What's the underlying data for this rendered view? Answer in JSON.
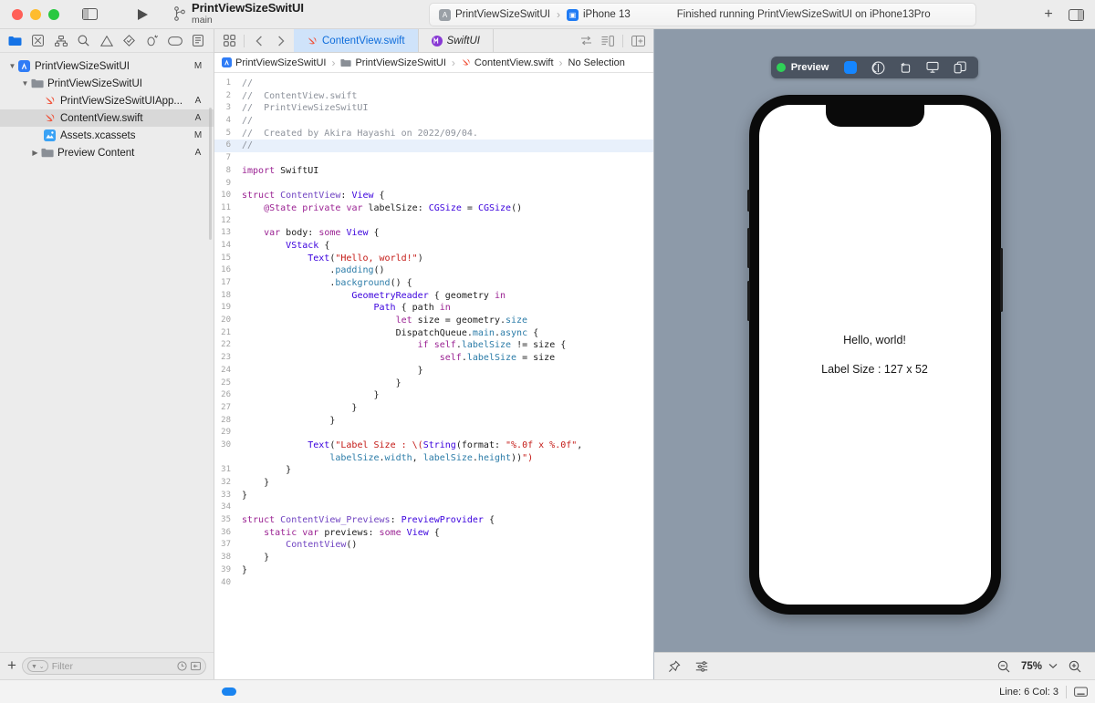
{
  "titlebar": {
    "project_name": "PrintViewSizeSwitUI",
    "branch": "main",
    "run_icon": "run-triangle-icon",
    "sidebar_toggle_icon": "sidebar-toggle-icon",
    "scheme": "PrintViewSizeSwitUI",
    "destination": "iPhone 13",
    "status_message": "Finished running PrintViewSizeSwitUI on iPhone13Pro",
    "add_label": "+",
    "inspector_toggle_icon": "inspector-toggle-icon"
  },
  "navigator": {
    "icons": [
      {
        "name": "folder-icon",
        "active": true
      },
      {
        "name": "source-control-icon",
        "active": false
      },
      {
        "name": "symbol-hierarchy-icon",
        "active": false
      },
      {
        "name": "search-icon",
        "active": false
      },
      {
        "name": "issue-warning-icon",
        "active": false
      },
      {
        "name": "test-diamond-icon",
        "active": false
      },
      {
        "name": "debug-icon",
        "active": false
      },
      {
        "name": "breakpoint-icon",
        "active": false
      },
      {
        "name": "report-icon",
        "active": false
      }
    ],
    "tree": [
      {
        "label": "PrintViewSizeSwitUI",
        "badge": "M",
        "indent": 0,
        "twisty": "open",
        "icon": "xcode-project-icon",
        "selected": false
      },
      {
        "label": "PrintViewSizeSwitUI",
        "badge": "",
        "indent": 1,
        "twisty": "open",
        "icon": "folder-icon",
        "selected": false
      },
      {
        "label": "PrintViewSizeSwitUIApp...",
        "badge": "A",
        "indent": 2,
        "twisty": "none",
        "icon": "swift-file-icon",
        "selected": false
      },
      {
        "label": "ContentView.swift",
        "badge": "A",
        "indent": 2,
        "twisty": "none",
        "icon": "swift-file-icon",
        "selected": true
      },
      {
        "label": "Assets.xcassets",
        "badge": "M",
        "indent": 2,
        "twisty": "none",
        "icon": "assets-icon",
        "selected": false
      },
      {
        "label": "Preview Content",
        "badge": "A",
        "indent": 1,
        "twisty": "closed",
        "icon": "folder-icon",
        "selected": false
      }
    ],
    "bottom": {
      "add_label": "+",
      "filter_placeholder": "Filter",
      "recent_icon": "clock-icon",
      "source-control-filter-icon": "source-control-filter-icon"
    }
  },
  "editor": {
    "tabs": [
      {
        "label": "ContentView.swift",
        "icon": "swift-file-icon",
        "active": true,
        "italic": false
      },
      {
        "label": "SwiftUI",
        "icon": "module-icon",
        "active": false,
        "italic": true
      }
    ],
    "lead_icons": [
      "grid-icon",
      "back-chevron-icon",
      "forward-chevron-icon"
    ],
    "right_icons": [
      "adjust-editor-icon",
      "split-editor-icon",
      "inspector-icon"
    ],
    "breadcrumb": [
      {
        "label": "PrintViewSizeSwitUI",
        "icon": "xcode-project-icon"
      },
      {
        "label": "PrintViewSizeSwitUI",
        "icon": "folder-icon"
      },
      {
        "label": "ContentView.swift",
        "icon": "swift-file-icon"
      },
      {
        "label": "No Selection",
        "icon": "none"
      }
    ],
    "highlighted_line": 6,
    "code": [
      {
        "n": 1,
        "tokens": [
          {
            "t": "//",
            "c": "cm"
          }
        ]
      },
      {
        "n": 2,
        "tokens": [
          {
            "t": "//  ContentView.swift",
            "c": "cm"
          }
        ]
      },
      {
        "n": 3,
        "tokens": [
          {
            "t": "//  PrintViewSizeSwitUI",
            "c": "cm"
          }
        ]
      },
      {
        "n": 4,
        "tokens": [
          {
            "t": "//",
            "c": "cm"
          }
        ]
      },
      {
        "n": 5,
        "tokens": [
          {
            "t": "//  Created by Akira Hayashi on 2022/09/04.",
            "c": "cm"
          }
        ]
      },
      {
        "n": 6,
        "tokens": [
          {
            "t": "//",
            "c": "cm"
          }
        ]
      },
      {
        "n": 7,
        "tokens": []
      },
      {
        "n": 8,
        "tokens": [
          {
            "t": "import",
            "c": "kw"
          },
          {
            "t": " ",
            "c": ""
          },
          {
            "t": "SwiftUI",
            "c": ""
          }
        ]
      },
      {
        "n": 9,
        "tokens": []
      },
      {
        "n": 10,
        "tokens": [
          {
            "t": "struct",
            "c": "kw"
          },
          {
            "t": " ",
            "c": ""
          },
          {
            "t": "ContentView",
            "c": "pl"
          },
          {
            "t": ": ",
            "c": ""
          },
          {
            "t": "View",
            "c": "ty"
          },
          {
            "t": " {",
            "c": ""
          }
        ]
      },
      {
        "n": 11,
        "tokens": [
          {
            "t": "    @State",
            "c": "kw"
          },
          {
            "t": " ",
            "c": ""
          },
          {
            "t": "private",
            "c": "kw"
          },
          {
            "t": " ",
            "c": ""
          },
          {
            "t": "var",
            "c": "kw"
          },
          {
            "t": " labelSize: ",
            "c": ""
          },
          {
            "t": "CGSize",
            "c": "ty"
          },
          {
            "t": " = ",
            "c": ""
          },
          {
            "t": "CGSize",
            "c": "ty"
          },
          {
            "t": "()",
            "c": ""
          }
        ]
      },
      {
        "n": 12,
        "tokens": []
      },
      {
        "n": 13,
        "tokens": [
          {
            "t": "    ",
            "c": ""
          },
          {
            "t": "var",
            "c": "kw"
          },
          {
            "t": " body: ",
            "c": ""
          },
          {
            "t": "some",
            "c": "kw"
          },
          {
            "t": " ",
            "c": ""
          },
          {
            "t": "View",
            "c": "ty"
          },
          {
            "t": " {",
            "c": ""
          }
        ]
      },
      {
        "n": 14,
        "tokens": [
          {
            "t": "        ",
            "c": ""
          },
          {
            "t": "VStack",
            "c": "ty"
          },
          {
            "t": " {",
            "c": ""
          }
        ]
      },
      {
        "n": 15,
        "tokens": [
          {
            "t": "            ",
            "c": ""
          },
          {
            "t": "Text",
            "c": "ty"
          },
          {
            "t": "(",
            "c": ""
          },
          {
            "t": "\"Hello, world!\"",
            "c": "str"
          },
          {
            "t": ")",
            "c": ""
          }
        ]
      },
      {
        "n": 16,
        "tokens": [
          {
            "t": "                .",
            "c": ""
          },
          {
            "t": "padding",
            "c": "fn"
          },
          {
            "t": "()",
            "c": ""
          }
        ]
      },
      {
        "n": 17,
        "tokens": [
          {
            "t": "                .",
            "c": ""
          },
          {
            "t": "background",
            "c": "fn"
          },
          {
            "t": "() {",
            "c": ""
          }
        ]
      },
      {
        "n": 18,
        "tokens": [
          {
            "t": "                    ",
            "c": ""
          },
          {
            "t": "GeometryReader",
            "c": "ty"
          },
          {
            "t": " { geometry ",
            "c": ""
          },
          {
            "t": "in",
            "c": "kw"
          }
        ]
      },
      {
        "n": 19,
        "tokens": [
          {
            "t": "                        ",
            "c": ""
          },
          {
            "t": "Path",
            "c": "ty"
          },
          {
            "t": " { path ",
            "c": ""
          },
          {
            "t": "in",
            "c": "kw"
          }
        ]
      },
      {
        "n": 20,
        "tokens": [
          {
            "t": "                            ",
            "c": ""
          },
          {
            "t": "let",
            "c": "kw"
          },
          {
            "t": " size = geometry.",
            "c": ""
          },
          {
            "t": "size",
            "c": "fn"
          }
        ]
      },
      {
        "n": 21,
        "tokens": [
          {
            "t": "                            DispatchQueue.",
            "c": ""
          },
          {
            "t": "main",
            "c": "fn"
          },
          {
            "t": ".",
            "c": ""
          },
          {
            "t": "async",
            "c": "fn"
          },
          {
            "t": " {",
            "c": ""
          }
        ]
      },
      {
        "n": 22,
        "tokens": [
          {
            "t": "                                ",
            "c": ""
          },
          {
            "t": "if",
            "c": "kw"
          },
          {
            "t": " ",
            "c": ""
          },
          {
            "t": "self",
            "c": "kw"
          },
          {
            "t": ".",
            "c": ""
          },
          {
            "t": "labelSize",
            "c": "fn"
          },
          {
            "t": " != size {",
            "c": ""
          }
        ]
      },
      {
        "n": 23,
        "tokens": [
          {
            "t": "                                    ",
            "c": ""
          },
          {
            "t": "self",
            "c": "kw"
          },
          {
            "t": ".",
            "c": ""
          },
          {
            "t": "labelSize",
            "c": "fn"
          },
          {
            "t": " = size",
            "c": ""
          }
        ]
      },
      {
        "n": 24,
        "tokens": [
          {
            "t": "                                }",
            "c": ""
          }
        ]
      },
      {
        "n": 25,
        "tokens": [
          {
            "t": "                            }",
            "c": ""
          }
        ]
      },
      {
        "n": 26,
        "tokens": [
          {
            "t": "                        }",
            "c": ""
          }
        ]
      },
      {
        "n": 27,
        "tokens": [
          {
            "t": "                    }",
            "c": ""
          }
        ]
      },
      {
        "n": 28,
        "tokens": [
          {
            "t": "                }",
            "c": ""
          }
        ]
      },
      {
        "n": 29,
        "tokens": []
      },
      {
        "n": 30,
        "tokens": [
          {
            "t": "            ",
            "c": ""
          },
          {
            "t": "Text",
            "c": "ty"
          },
          {
            "t": "(",
            "c": ""
          },
          {
            "t": "\"Label Size : \\(",
            "c": "str"
          },
          {
            "t": "String",
            "c": "ty"
          },
          {
            "t": "(format: ",
            "c": ""
          },
          {
            "t": "\"%.0f x %.0f\"",
            "c": "str"
          },
          {
            "t": ",",
            "c": ""
          }
        ],
        "cont": [
          {
            "t": "                ",
            "c": ""
          },
          {
            "t": "labelSize",
            "c": "fn"
          },
          {
            "t": ".",
            "c": ""
          },
          {
            "t": "width",
            "c": "fn"
          },
          {
            "t": ", ",
            "c": ""
          },
          {
            "t": "labelSize",
            "c": "fn"
          },
          {
            "t": ".",
            "c": ""
          },
          {
            "t": "height",
            "c": "fn"
          },
          {
            "t": "))",
            "c": ""
          },
          {
            "t": "\")",
            "c": "str"
          }
        ]
      },
      {
        "n": 31,
        "tokens": [
          {
            "t": "        }",
            "c": ""
          }
        ]
      },
      {
        "n": 32,
        "tokens": [
          {
            "t": "    }",
            "c": ""
          }
        ]
      },
      {
        "n": 33,
        "tokens": [
          {
            "t": "}",
            "c": ""
          }
        ]
      },
      {
        "n": 34,
        "tokens": []
      },
      {
        "n": 35,
        "tokens": [
          {
            "t": "struct",
            "c": "kw"
          },
          {
            "t": " ",
            "c": ""
          },
          {
            "t": "ContentView_Previews",
            "c": "pl"
          },
          {
            "t": ": ",
            "c": ""
          },
          {
            "t": "PreviewProvider",
            "c": "ty"
          },
          {
            "t": " {",
            "c": ""
          }
        ]
      },
      {
        "n": 36,
        "tokens": [
          {
            "t": "    ",
            "c": ""
          },
          {
            "t": "static",
            "c": "kw"
          },
          {
            "t": " ",
            "c": ""
          },
          {
            "t": "var",
            "c": "kw"
          },
          {
            "t": " previews: ",
            "c": ""
          },
          {
            "t": "some",
            "c": "kw"
          },
          {
            "t": " ",
            "c": ""
          },
          {
            "t": "View",
            "c": "ty"
          },
          {
            "t": " {",
            "c": ""
          }
        ]
      },
      {
        "n": 37,
        "tokens": [
          {
            "t": "        ",
            "c": ""
          },
          {
            "t": "ContentView",
            "c": "pl"
          },
          {
            "t": "()",
            "c": ""
          }
        ]
      },
      {
        "n": 38,
        "tokens": [
          {
            "t": "    }",
            "c": ""
          }
        ]
      },
      {
        "n": 39,
        "tokens": [
          {
            "t": "}",
            "c": ""
          }
        ]
      },
      {
        "n": 40,
        "tokens": []
      }
    ]
  },
  "canvas": {
    "preview_toolbar": {
      "status_dot_color": "#2fd157",
      "label": "Preview",
      "buttons": [
        "live-preview-icon",
        "selectable-preview-icon",
        "rotate-device-icon",
        "device-settings-icon",
        "duplicate-preview-icon"
      ]
    },
    "preview_content": {
      "hello_text": "Hello, world!",
      "label_size_text": "Label Size : 127 x 52"
    },
    "bottom_bar": {
      "pin_icon": "pin-icon",
      "variants_icon": "preview-variants-icon",
      "zoom_out_icon": "zoom-out-icon",
      "zoom_level": "75%",
      "chevron_icon": "chevron-down-icon",
      "zoom_in_icon": "zoom-in-icon"
    }
  },
  "statusbar": {
    "line_col": "Line: 6  Col: 3",
    "keyboard_icon": "keyboard-icon"
  },
  "colors": {
    "accent_blue": "#1573e6",
    "tab_active_bg": "#cfe3fa",
    "canvas_bg": "#8d9aa9",
    "preview_toolbar_bg": "#4a5360"
  }
}
